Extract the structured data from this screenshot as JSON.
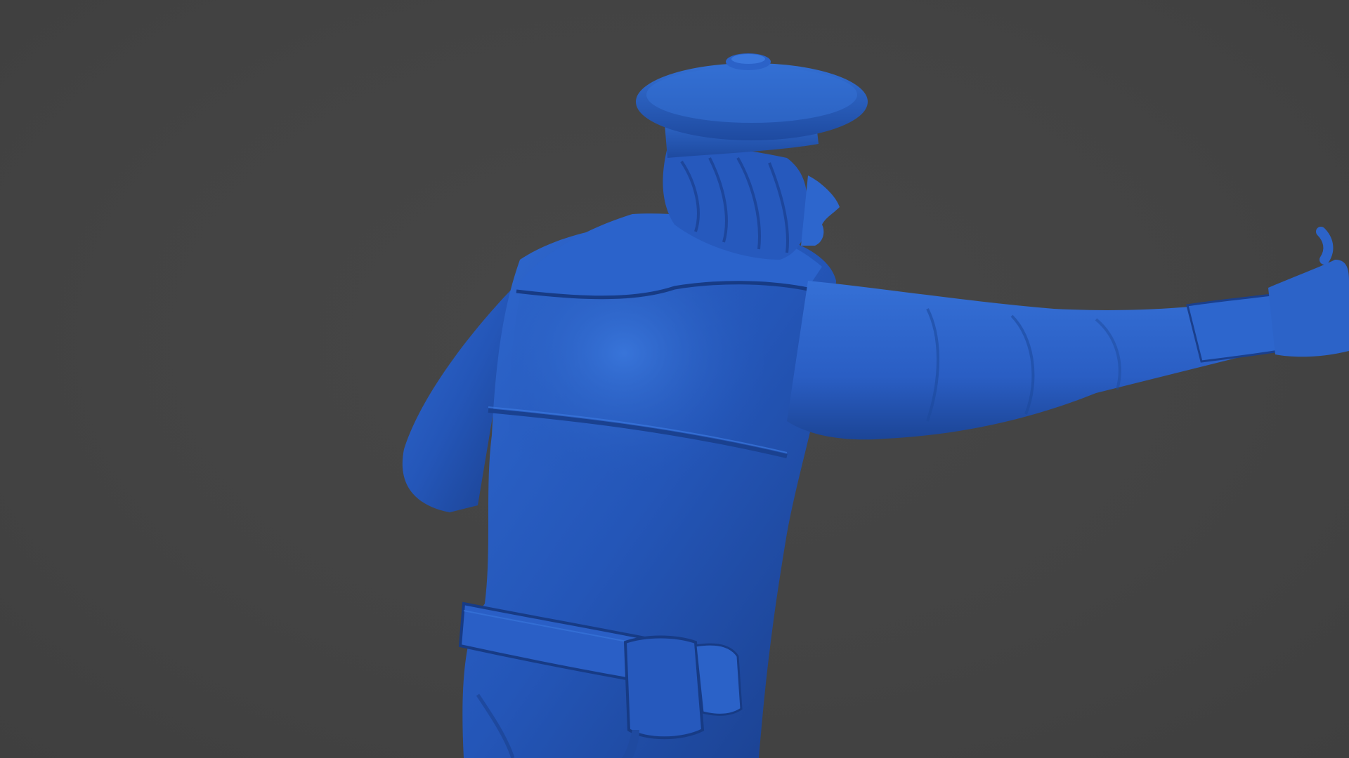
{
  "scene": {
    "background_color": "#444444",
    "material_color": "#2456b8",
    "subject": "sculpted-sailor-figure",
    "view": "rear-three-quarter"
  }
}
